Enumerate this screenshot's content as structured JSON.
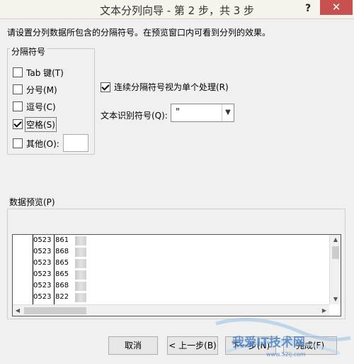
{
  "window": {
    "title": "文本分列向导 - 第 2 步，共 3 步",
    "help_label": "?",
    "close_label": "✕"
  },
  "instruction": "请设置分列数据所包含的分隔符号。在预览窗口内可看到分列的效果。",
  "delimiters": {
    "legend": "分隔符号",
    "tab": {
      "label": "Tab 键(T)",
      "checked": false
    },
    "semicolon": {
      "label": "分号(M)",
      "checked": false
    },
    "comma": {
      "label": "逗号(C)",
      "checked": false
    },
    "space": {
      "label": "空格(S)",
      "checked": true
    },
    "other": {
      "label": "其他(O):",
      "checked": false,
      "value": ""
    }
  },
  "consecutive": {
    "label": "连续分隔符号视为单个处理(R)",
    "checked": true
  },
  "text_qualifier": {
    "label": "文本识别符号(Q):",
    "value": "\""
  },
  "preview": {
    "label": "数据预览(P)",
    "rows": [
      {
        "a": "0523",
        "b": "861"
      },
      {
        "a": "0523",
        "b": "868"
      },
      {
        "a": "0523",
        "b": "865"
      },
      {
        "a": "0523",
        "b": "865"
      },
      {
        "a": "0523",
        "b": "868"
      },
      {
        "a": "0523",
        "b": "822"
      }
    ]
  },
  "buttons": {
    "cancel": "取消",
    "prev": "< 上一步(B)",
    "next": "下一步(N)",
    "finish": "完成(F)"
  },
  "watermark": {
    "text": "我爱IT技术网",
    "url": "www.52ij.com"
  }
}
